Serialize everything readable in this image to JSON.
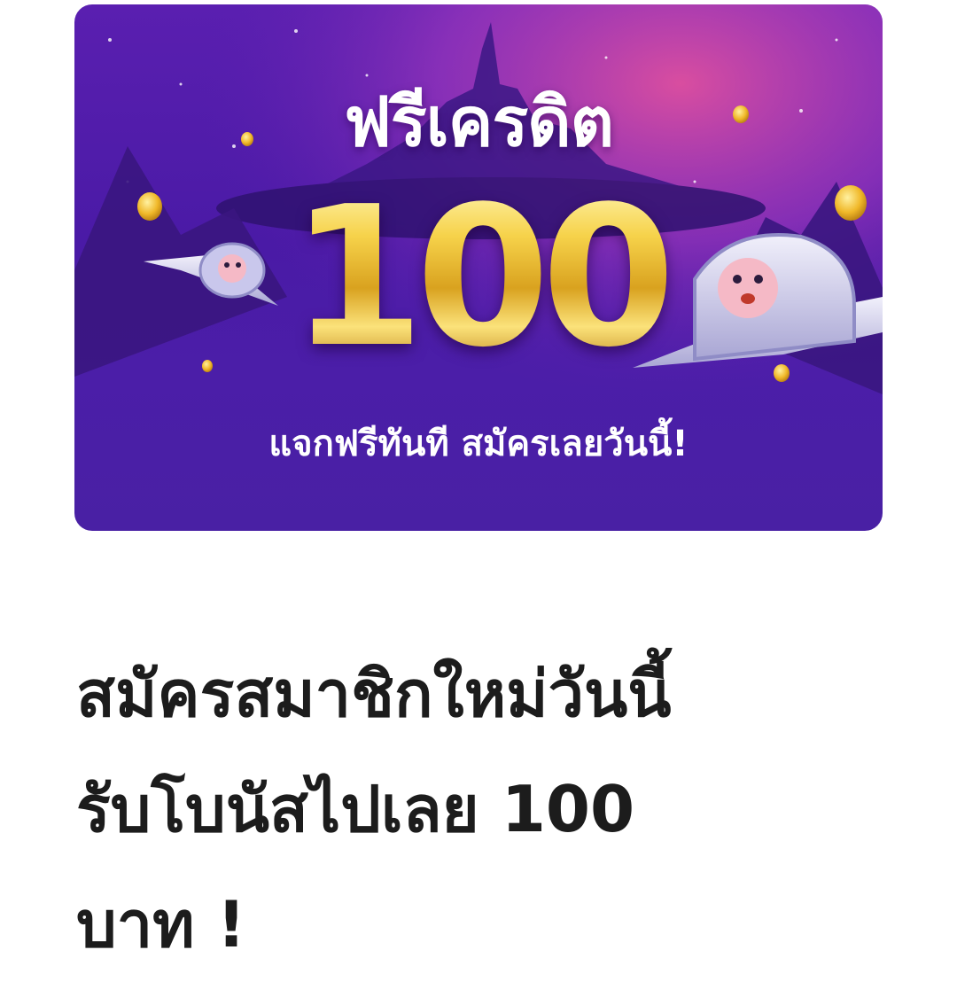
{
  "banner": {
    "title": "ฟรีเครดิต",
    "amount": "100",
    "subtitle": "แจกฟรีทันที สมัครเลยวันนี้!",
    "colors": {
      "background": "#4a1aa6",
      "sky_highlight": "#d9479e",
      "gold": "#f2c53a",
      "text": "#ffffff"
    },
    "icons": [
      "castle-silhouette",
      "gold-coin",
      "spaceship-pig-left",
      "spaceship-pig-right"
    ]
  },
  "headline": {
    "line1": "สมัครสมาชิกใหม่วันนี้",
    "line2": "รับโบนัสไปเลย 100",
    "line3": "บาท !",
    "color": "#1c1c1c"
  }
}
